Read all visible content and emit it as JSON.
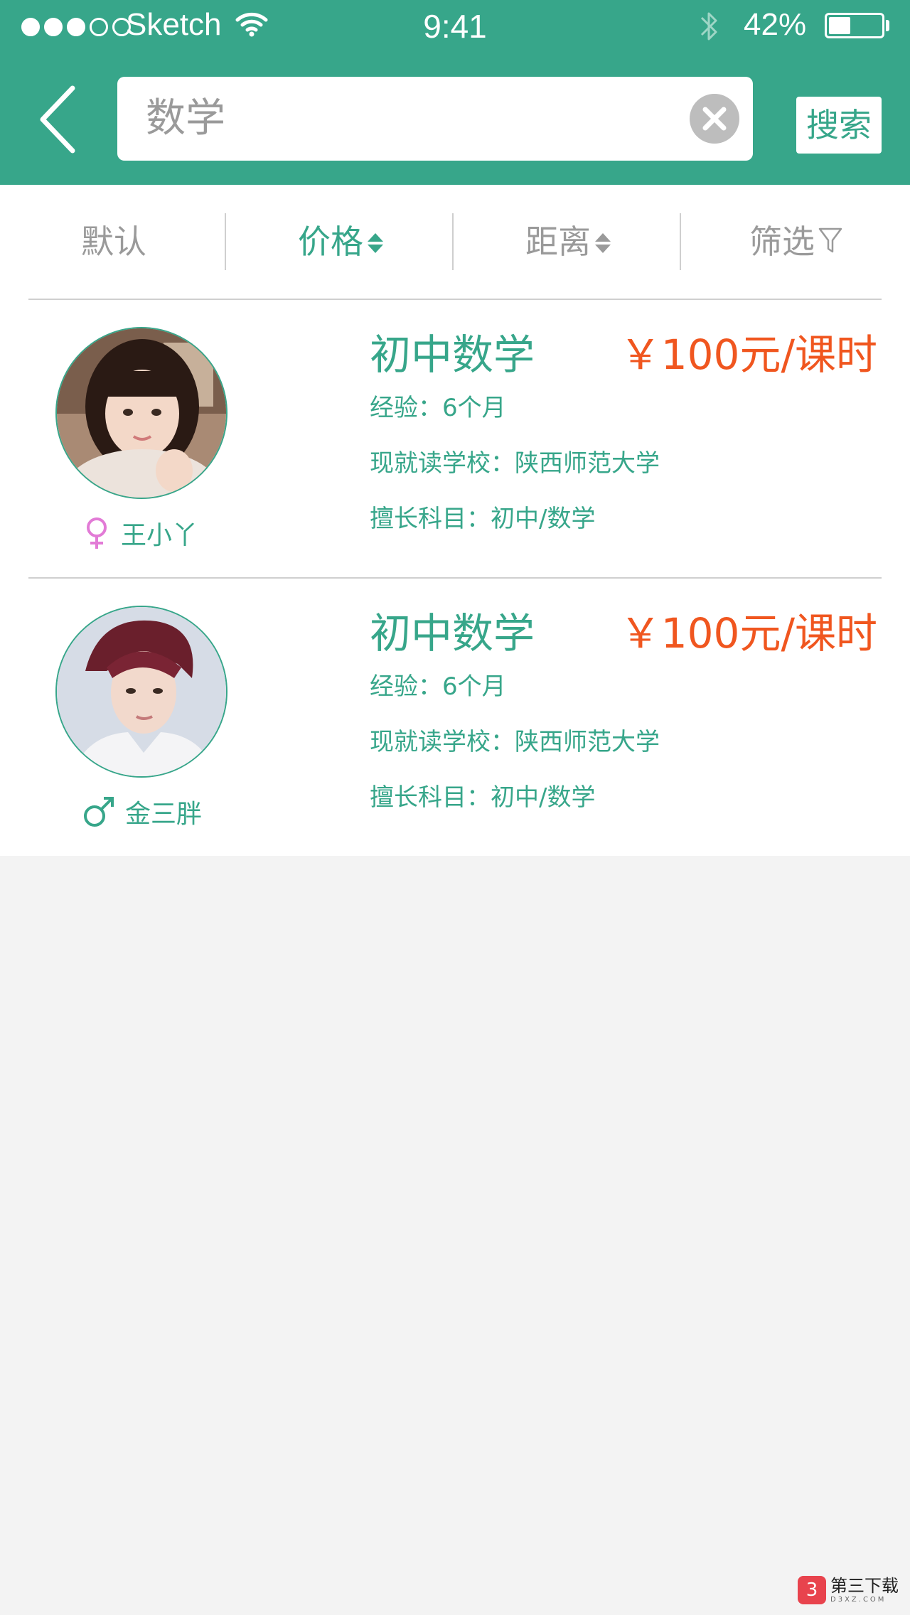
{
  "status_bar": {
    "carrier": "Sketch",
    "time": "9:41",
    "battery_percent": "42%",
    "battery_level": 0.42
  },
  "search": {
    "value": "数学",
    "button_label": "搜索"
  },
  "sort_bar": {
    "items": [
      {
        "label": "默认",
        "active": false
      },
      {
        "label": "价格",
        "active": true
      },
      {
        "label": "距离",
        "active": false
      },
      {
        "label": "筛选",
        "active": false
      }
    ]
  },
  "colors": {
    "accent": "#37a68a",
    "price": "#f0561f",
    "female": "#e27bd6",
    "male": "#37a68a",
    "page_bg": "#f3f3f3"
  },
  "results": [
    {
      "name": "王小丫",
      "gender": "female",
      "gender_icon": "female-icon",
      "course": "初中数学",
      "price": "￥100元/课时",
      "experience": "经验：6个月",
      "school": "现就读学校：陕西师范大学",
      "subjects": "擅长科目：初中/数学"
    },
    {
      "name": "金三胖",
      "gender": "male",
      "gender_icon": "male-icon",
      "course": "初中数学",
      "price": "￥100元/课时",
      "experience": "经验：6个月",
      "school": "现就读学校：陕西师范大学",
      "subjects": "擅长科目：初中/数学"
    }
  ],
  "watermark": {
    "logo_glyph": "3",
    "text": "第三下载",
    "subtext": "D3XZ.COM"
  }
}
